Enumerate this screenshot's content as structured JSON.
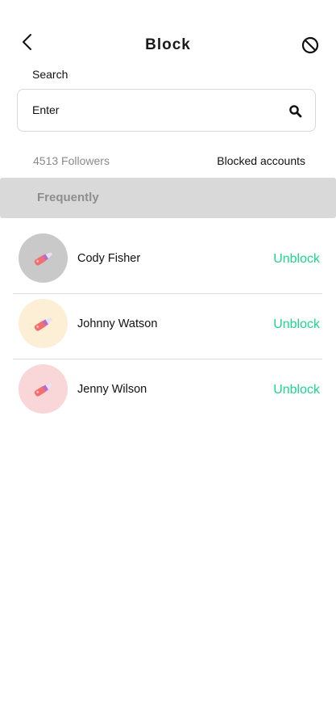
{
  "header": {
    "title": "Block",
    "back_icon": "chevron-left-icon",
    "block_icon": "block-icon"
  },
  "search": {
    "label": "Search",
    "placeholder": "Enter",
    "icon": "search-icon"
  },
  "stats": {
    "followers": "4513 Followers",
    "blocked_tab": "Blocked accounts"
  },
  "section": {
    "label": "Frequently"
  },
  "users": [
    {
      "name": "Cody Fisher",
      "action": "Unblock",
      "avatar_bg": "#c9c9c9"
    },
    {
      "name": "Johnny Watson",
      "action": "Unblock",
      "avatar_bg": "#fdefd5"
    },
    {
      "name": "Jenny Wilson",
      "action": "Unblock",
      "avatar_bg": "#f9d6d8"
    }
  ],
  "colors": {
    "accent": "#1ed48f",
    "band": "#d9d9d9",
    "muted_text": "#8a8a8a"
  }
}
